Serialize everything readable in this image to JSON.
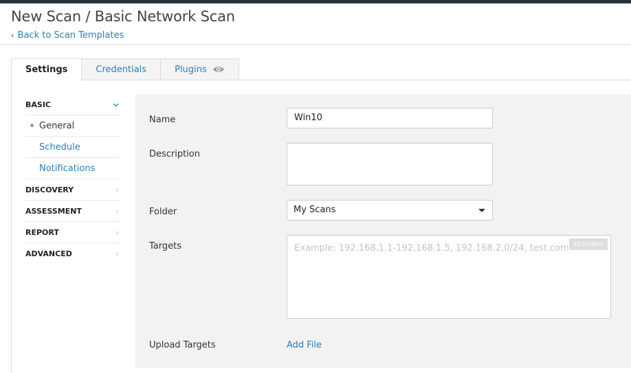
{
  "header": {
    "title": "New Scan / Basic Network Scan",
    "back_link": "Back to Scan Templates"
  },
  "tabs": [
    {
      "label": "Settings",
      "active": true
    },
    {
      "label": "Credentials",
      "active": false
    },
    {
      "label": "Plugins",
      "active": false,
      "icon": "eye-icon"
    }
  ],
  "sidebar": {
    "sections": [
      {
        "label": "BASIC",
        "expanded": true,
        "icon": "chevron-down-icon",
        "items": [
          {
            "label": "General",
            "current": true
          },
          {
            "label": "Schedule",
            "current": false
          },
          {
            "label": "Notifications",
            "current": false
          }
        ]
      },
      {
        "label": "DISCOVERY",
        "expanded": false,
        "icon": "chevron-right-icon"
      },
      {
        "label": "ASSESSMENT",
        "expanded": false,
        "icon": "chevron-right-icon"
      },
      {
        "label": "REPORT",
        "expanded": false,
        "icon": "chevron-right-icon"
      },
      {
        "label": "ADVANCED",
        "expanded": false,
        "icon": "chevron-right-icon"
      }
    ]
  },
  "form": {
    "name": {
      "label": "Name",
      "value": "Win10"
    },
    "description": {
      "label": "Description",
      "value": ""
    },
    "folder": {
      "label": "Folder",
      "value": "My Scans"
    },
    "targets": {
      "label": "Targets",
      "placeholder": "Example: 192.168.1.1-192.168.1.5, 192.168.2.0/24, test.com",
      "required_badge": "REQUIRED"
    },
    "upload_targets": {
      "label": "Upload Targets",
      "action": "Add File"
    }
  },
  "colors": {
    "topbar": "#263238",
    "link": "#2a7fb8",
    "panel_bg": "#f2f2f2"
  }
}
